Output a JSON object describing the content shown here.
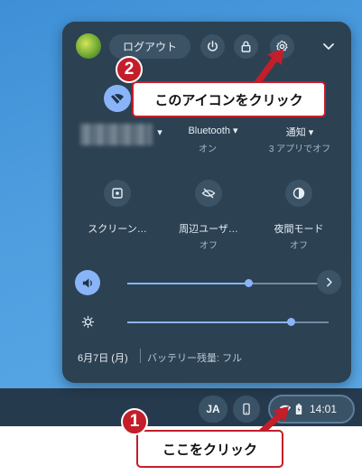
{
  "header": {
    "logout_label": "ログアウト"
  },
  "tiles": [
    {
      "label": "",
      "sub": ""
    },
    {
      "label": "Bluetooth ▾",
      "sub": "オン"
    },
    {
      "label": "通知 ▾",
      "sub": "3 アプリでオフ"
    },
    {
      "label": "スクリーン…",
      "sub": ""
    },
    {
      "label": "周辺ユーザ…",
      "sub": "オフ"
    },
    {
      "label": "夜間モード",
      "sub": "オフ"
    }
  ],
  "sliders": {
    "volume_level": 0.6,
    "brightness_level": 0.81
  },
  "footer": {
    "date": "6月7日 (月)",
    "battery": "バッテリー残量: フル"
  },
  "shelf": {
    "ime": "JA",
    "time": "14:01"
  },
  "annotations": {
    "step1_number": "1",
    "step1_text": "ここをクリック",
    "step2_number": "2",
    "step2_text": "このアイコンをクリック"
  },
  "colors": {
    "panel": "#2c4152",
    "accent": "#8ab4f8",
    "callout_red": "#c31e2a"
  }
}
